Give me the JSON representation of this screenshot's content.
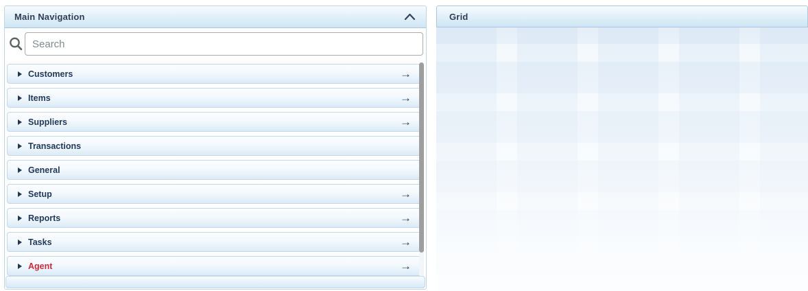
{
  "left_panel": {
    "title": "Main Navigation",
    "collapse_icon": "chevron-up",
    "search": {
      "placeholder": "Search",
      "value": ""
    },
    "glyphs": {
      "expand_triangle": "right-triangle",
      "drill_arrow": "→"
    },
    "menu_items": [
      {
        "label": "Customers",
        "drill_arrow": true,
        "accent": "navy"
      },
      {
        "label": "Items",
        "drill_arrow": true,
        "accent": "navy"
      },
      {
        "label": "Suppliers",
        "drill_arrow": true,
        "accent": "navy"
      },
      {
        "label": "Transactions",
        "drill_arrow": false,
        "accent": "navy"
      },
      {
        "label": "General",
        "drill_arrow": false,
        "accent": "navy"
      },
      {
        "label": "Setup",
        "drill_arrow": true,
        "accent": "navy"
      },
      {
        "label": "Reports",
        "drill_arrow": true,
        "accent": "navy"
      },
      {
        "label": "Tasks",
        "drill_arrow": true,
        "accent": "navy"
      },
      {
        "label": "Agent",
        "drill_arrow": true,
        "accent": "red"
      }
    ]
  },
  "right_panel": {
    "title": "Grid"
  },
  "colors": {
    "navy_text": "#21395c",
    "red_text": "#cb2b3d",
    "header_gradient_top": "#f6fbfe",
    "header_gradient_bottom": "#cfe5f4",
    "header_border": "#a9c6e0",
    "item_border": "#c3d8ea",
    "scrollbar_thumb": "#9e9e9e"
  }
}
